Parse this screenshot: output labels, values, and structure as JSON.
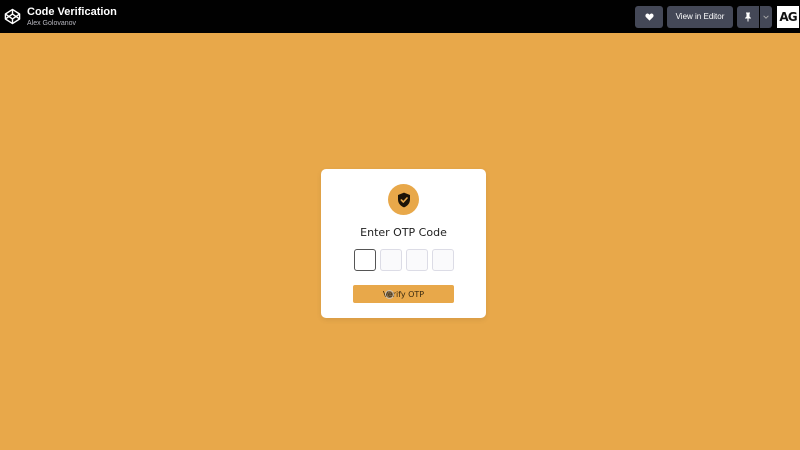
{
  "header": {
    "title": "Code Verification",
    "author": "Alex Golovanov",
    "view_in_editor_label": "View in Editor",
    "avatar_initials": "AG",
    "logo_icon": "codepen-icon",
    "heart_icon": "heart-icon",
    "pin_icon": "pin-icon",
    "dropdown_icon": "chevron-down-icon"
  },
  "card": {
    "icon": "shield-check-icon",
    "heading": "Enter OTP Code",
    "otp_values": [
      "",
      "",
      "",
      ""
    ],
    "verify_label": "Verify OTP"
  },
  "colors": {
    "background": "#e8a84a",
    "topbar": "#010101",
    "button": "#444857",
    "card": "#ffffff"
  }
}
